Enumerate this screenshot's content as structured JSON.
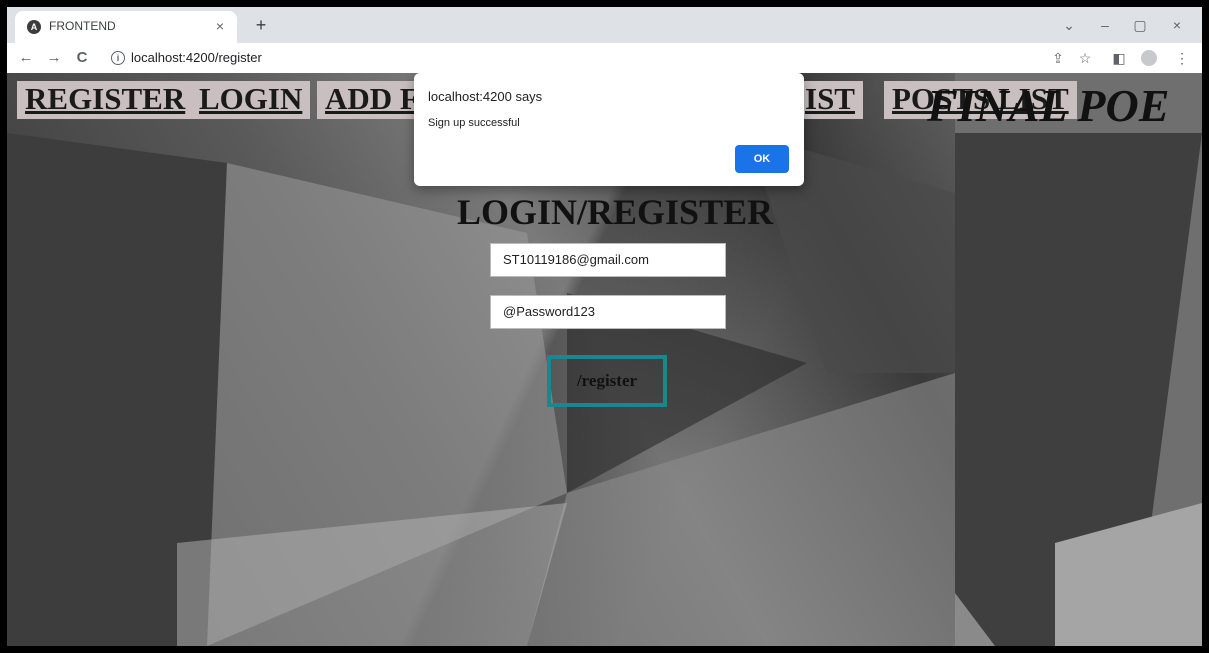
{
  "tab": {
    "title": "FRONTEND",
    "favicon": "A",
    "close": "×"
  },
  "newtab": "+",
  "window": {
    "minimize": "–",
    "restore": "▢",
    "close": "×",
    "chevron": "⌄"
  },
  "toolbar": {
    "back": "←",
    "forward": "→",
    "reload": "C",
    "info": "i",
    "url": "localhost:4200/register",
    "share": "⇪",
    "star": "☆",
    "sidebar": "◧",
    "menu": "⋮"
  },
  "nav": {
    "register": "REGISTER",
    "login": "LOGIN",
    "add": "ADD FI",
    "list": "IST",
    "posts": "POSTS LIST"
  },
  "final_title": "FINAL POE",
  "heading": "LOGIN/REGISTER",
  "form": {
    "email": "ST10119186@gmail.com",
    "password": "@Password123",
    "submit": "/register"
  },
  "dialog": {
    "title": "localhost:4200 says",
    "message": "Sign up successful",
    "ok": "OK"
  },
  "colors": {
    "accent": "#1a73e8",
    "submit_border": "#17898a",
    "nav_bg": "#c9bfc0"
  }
}
